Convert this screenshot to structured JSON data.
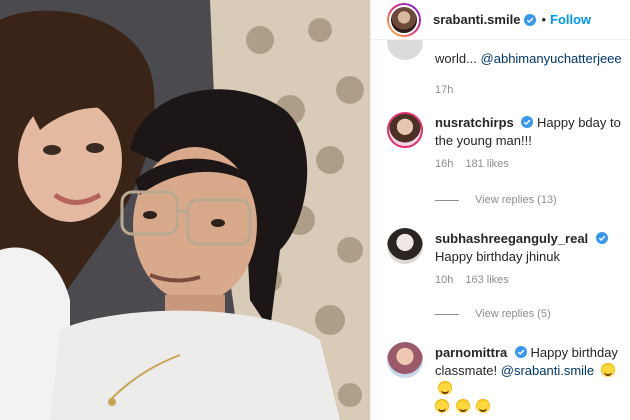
{
  "post": {
    "author": "srabanti.smile",
    "follow_label": "Follow",
    "separator": "•"
  },
  "comments": [
    {
      "username": "",
      "text": "world...",
      "mention": "@abhimanyuchatterjeee",
      "time": "17h",
      "likes": ""
    },
    {
      "username": "nusratchirps",
      "verified": true,
      "text": "Happy bday to the young man!!!",
      "time": "16h",
      "likes": "181 likes",
      "view_replies": "View replies (13)"
    },
    {
      "username": "subhashreeganguly_real",
      "verified": true,
      "text": "Happy birthday jhinuk",
      "time": "10h",
      "likes": "163 likes",
      "view_replies": "View replies (5)"
    },
    {
      "username": "parnomittra",
      "verified": true,
      "text": "Happy birthday classmate!",
      "mention": "@srabanti.smile",
      "time": "",
      "likes": ""
    }
  ],
  "colors": {
    "accent": "#0095f6",
    "verified": "#3897f0",
    "mention": "#00376b",
    "muted": "#8e8e8e"
  },
  "icons": [
    "verified-badge-icon",
    "smile-emoji-icon"
  ]
}
